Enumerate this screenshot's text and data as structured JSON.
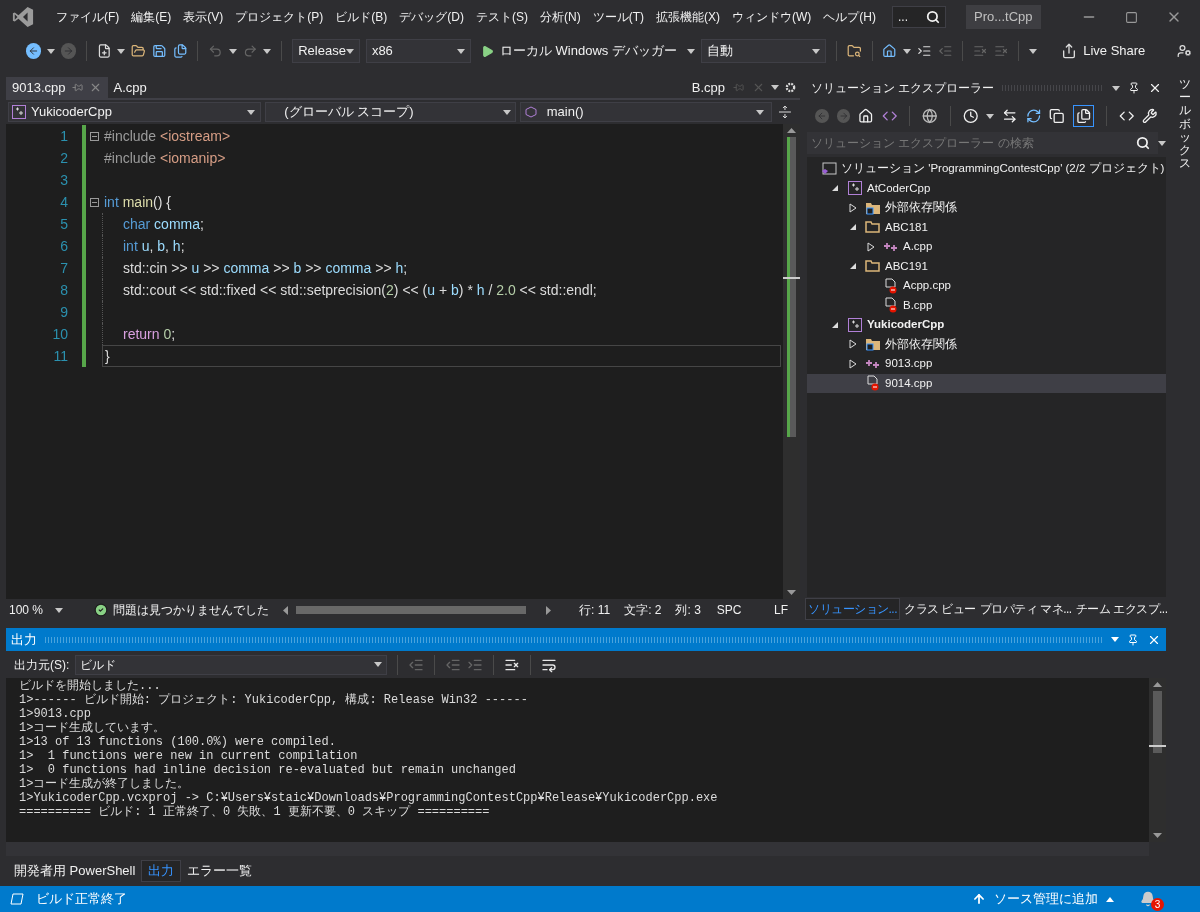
{
  "menu": [
    "ファイル(F)",
    "編集(E)",
    "表示(V)",
    "プロジェクト(P)",
    "ビルド(B)",
    "デバッグ(D)",
    "テスト(S)",
    "分析(N)",
    "ツール(T)",
    "拡張機能(X)",
    "ウィンドウ(W)",
    "ヘルプ(H)"
  ],
  "search": {
    "value": "..."
  },
  "window_title": "Pro...tCpp",
  "toolbar": {
    "configuration": "Release",
    "platform": "x86",
    "start": "ローカル Windows デバッガー",
    "stack_frame": "自動",
    "live_share": "Live Share"
  },
  "editor": {
    "tabs": [
      {
        "label": "9013.cpp",
        "selected": true
      },
      {
        "label": "A.cpp",
        "selected": false
      }
    ],
    "preview_tab": {
      "label": "B.cpp"
    },
    "nav": {
      "project": "YukicoderCpp",
      "scope": "(グローバル スコープ)",
      "member": "main()"
    },
    "lines": [
      {
        "number": "1",
        "foldable": true,
        "indented": false,
        "current": false,
        "tokens": [
          {
            "t": "#include",
            "kind": "preproc"
          },
          {
            "t": " <iostream>",
            "kind": "include"
          }
        ]
      },
      {
        "number": "2",
        "foldable": false,
        "indented": false,
        "current": false,
        "tokens": [
          {
            "t": "#include",
            "kind": "preproc"
          },
          {
            "t": " <iomanip>",
            "kind": "include"
          }
        ]
      },
      {
        "number": "3",
        "foldable": false
      },
      {
        "number": "4",
        "foldable": true,
        "indented": false,
        "current": false,
        "tokens": [
          {
            "t": "int",
            "kind": "keyword"
          },
          {
            "t": " main",
            "kind": "func"
          },
          {
            "t": "() {",
            "kind": "plain"
          }
        ]
      },
      {
        "number": "5",
        "foldable": false,
        "indented": true,
        "current": false,
        "tokens": [
          {
            "t": "char",
            "kind": "keyword"
          },
          {
            "t": " comma",
            "kind": "variable"
          },
          {
            "t": ";",
            "kind": "plain"
          }
        ]
      },
      {
        "number": "6",
        "foldable": false,
        "indented": true,
        "current": false,
        "tokens": [
          {
            "t": "int",
            "kind": "keyword"
          },
          {
            "t": " u",
            "kind": "variable"
          },
          {
            "t": ", ",
            "kind": "plain"
          },
          {
            "t": "b",
            "kind": "variable"
          },
          {
            "t": ", ",
            "kind": "plain"
          },
          {
            "t": "h",
            "kind": "variable"
          },
          {
            "t": ";",
            "kind": "plain"
          }
        ]
      },
      {
        "number": "7",
        "foldable": false,
        "indented": true,
        "current": false,
        "tokens": [
          {
            "t": "std::cin >> ",
            "kind": "plain"
          },
          {
            "t": "u",
            "kind": "variable"
          },
          {
            "t": " >> ",
            "kind": "plain"
          },
          {
            "t": "comma",
            "kind": "variable"
          },
          {
            "t": " >> ",
            "kind": "plain"
          },
          {
            "t": "b",
            "kind": "variable"
          },
          {
            "t": " >> ",
            "kind": "plain"
          },
          {
            "t": "comma",
            "kind": "variable"
          },
          {
            "t": " >> ",
            "kind": "plain"
          },
          {
            "t": "h",
            "kind": "variable"
          },
          {
            "t": ";",
            "kind": "plain"
          }
        ]
      },
      {
        "number": "8",
        "foldable": false,
        "indented": true,
        "current": false,
        "tokens": [
          {
            "t": "std::cout << std::fixed << std::setprecision(",
            "kind": "plain"
          },
          {
            "t": "2",
            "kind": "number"
          },
          {
            "t": ") << (",
            "kind": "plain"
          },
          {
            "t": "u",
            "kind": "variable"
          },
          {
            "t": " + ",
            "kind": "plain"
          },
          {
            "t": "b",
            "kind": "variable"
          },
          {
            "t": ") * ",
            "kind": "plain"
          },
          {
            "t": "h",
            "kind": "variable"
          },
          {
            "t": " / ",
            "kind": "plain"
          },
          {
            "t": "2.0",
            "kind": "number"
          },
          {
            "t": " << std::endl;",
            "kind": "plain"
          }
        ]
      },
      {
        "number": "9",
        "foldable": false
      },
      {
        "number": "10",
        "foldable": false,
        "indented": true,
        "current": false,
        "tokens": [
          {
            "t": "return",
            "kind": "control"
          },
          {
            "t": " 0",
            "kind": "number"
          },
          {
            "t": ";",
            "kind": "plain"
          }
        ]
      },
      {
        "number": "11",
        "foldable": false,
        "indented": false,
        "current": true,
        "tokens": [
          {
            "t": "}",
            "kind": "plain"
          }
        ]
      }
    ],
    "status": {
      "zoom": "100 %",
      "issues": "問題は見つかりませんでした",
      "line": "行: 11",
      "char": "文字: 2",
      "col": "列: 3",
      "whitespace": "SPC",
      "eol": "LF"
    }
  },
  "solution_explorer": {
    "title": "ソリューション エクスプローラー",
    "search_placeholder": "ソリューション エクスプローラー の検索",
    "tree": [
      {
        "label": "ソリューション 'ProgrammingContestCpp' (2/2 プロジェクト)",
        "kind": "solution",
        "selected": false,
        "children": [
          {
            "label": "AtCoderCpp",
            "kind": "project",
            "startup": false,
            "selected": false,
            "expanded": true,
            "children": [
              {
                "label": "外部依存関係",
                "kind": "references",
                "selected": false,
                "expanded": false
              },
              {
                "label": "ABC181",
                "kind": "folder",
                "selected": false,
                "expanded": true,
                "children": [
                  {
                    "label": "A.cpp",
                    "kind": "cpp",
                    "selected": false,
                    "expanded": false
                  }
                ]
              },
              {
                "label": "ABC191",
                "kind": "folder",
                "selected": false,
                "expanded": true,
                "children": [
                  {
                    "label": "Acpp.cpp",
                    "kind": "excluded",
                    "selected": false
                  },
                  {
                    "label": "B.cpp",
                    "kind": "excluded",
                    "selected": false
                  }
                ]
              }
            ]
          },
          {
            "label": "YukicoderCpp",
            "kind": "project",
            "startup": true,
            "selected": false,
            "expanded": true,
            "children": [
              {
                "label": "外部依存関係",
                "kind": "references",
                "selected": false,
                "expanded": false
              },
              {
                "label": "9013.cpp",
                "kind": "cpp",
                "selected": false,
                "expanded": false
              },
              {
                "label": "9014.cpp",
                "kind": "excluded",
                "selected": true
              }
            ]
          }
        ]
      }
    ],
    "tabs": [
      {
        "label": "ソリューション...",
        "selected": true
      },
      {
        "label": "クラス ビュー",
        "selected": false
      },
      {
        "label": "プロパティ マネ...",
        "selected": false
      },
      {
        "label": "チーム エクスプ...",
        "selected": false
      }
    ]
  },
  "toolbox": "ツールボックス",
  "output": {
    "title": "出力",
    "source_label": "出力元(S):",
    "source": "ビルド",
    "lines": [
      "ビルドを開始しました...",
      "1>------ ビルド開始: プロジェクト: YukicoderCpp, 構成: Release Win32 ------",
      "1>9013.cpp",
      "1>コード生成しています。",
      "1>13 of 13 functions (100.0%) were compiled.",
      "1>  1 functions were new in current compilation",
      "1>  0 functions had inline decision re-evaluated but remain unchanged",
      "1>コード生成が終了しました。",
      "1>YukicoderCpp.vcxproj -> C:¥Users¥staic¥Downloads¥ProgrammingContestCpp¥Release¥YukicoderCpp.exe",
      "========== ビルド: 1 正常終了、0 失敗、1 更新不要、0 スキップ =========="
    ],
    "tabs": [
      {
        "label": "開発者用 PowerShell",
        "selected": false
      },
      {
        "label": "出力",
        "selected": true
      },
      {
        "label": "エラー一覧",
        "selected": false
      }
    ]
  },
  "status_bar": {
    "message": "ビルド正常終了",
    "source_control": "ソース管理に追加",
    "notifications": "3"
  }
}
